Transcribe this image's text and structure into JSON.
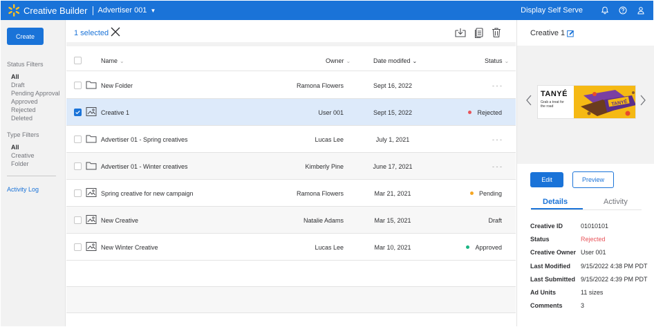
{
  "app": {
    "brand": "Creative Builder",
    "advertiser": "Advertiser 001",
    "right_link": "Display Self Serve",
    "icons": [
      "bell-icon",
      "help-icon",
      "user-icon"
    ],
    "accent": "#1a73d8"
  },
  "sidebar": {
    "create_label": "Create",
    "status_title": "Status Filters",
    "status_items": [
      "All",
      "Draft",
      "Pending Approval",
      "Approved",
      "Rejected",
      "Deleted"
    ],
    "type_title": "Type Filters",
    "type_items": [
      "All",
      "Creative",
      "Folder"
    ],
    "activity_log": "Activity Log"
  },
  "actionbar": {
    "selected_text": "1 selected",
    "icons": [
      "download-icon",
      "copy-icon",
      "trash-icon"
    ]
  },
  "table": {
    "headers": {
      "name": "Name",
      "owner": "Owner",
      "date": "Date modifed",
      "status": "Status"
    },
    "rows": [
      {
        "type": "folder",
        "name": "New Folder",
        "owner": "Ramona Flowers",
        "date": "Sept 16, 2022",
        "status": "- - -",
        "dot": "",
        "checked": false
      },
      {
        "type": "creative",
        "name": "Creative 1",
        "owner": "User 001",
        "date": "Sept 15, 2022",
        "status": "Rejected",
        "dot": "#e8545a",
        "checked": true
      },
      {
        "type": "folder",
        "name": "Advertiser 01 - Spring creatives",
        "owner": "Lucas Lee",
        "date": "July 1, 2021",
        "status": "- - -",
        "dot": "",
        "checked": false
      },
      {
        "type": "folder",
        "name": "Advertiser 01 - Winter creatives",
        "owner": "Kimberly Pine",
        "date": "June 17, 2021",
        "status": "- - -",
        "dot": "",
        "checked": false
      },
      {
        "type": "creative",
        "name": "Spring creative for new campaign",
        "owner": "Ramona Flowers",
        "date": "Mar 21, 2021",
        "status": "Pending",
        "dot": "#f5a623",
        "checked": false
      },
      {
        "type": "creative",
        "name": "New Creative",
        "owner": "Natalie Adams",
        "date": "Mar 15, 2021",
        "status": "Draft",
        "dot": "",
        "checked": false
      },
      {
        "type": "creative",
        "name": "New Winter Creative",
        "owner": "Lucas Lee",
        "date": "Mar 10, 2021",
        "status": "Approved",
        "dot": "#1bb583",
        "checked": false
      }
    ]
  },
  "panel": {
    "title": "Creative 1",
    "banner": {
      "brand": "TANYÉ",
      "tagline": "Grab a treat for the road"
    },
    "edit_label": "Edit",
    "preview_label": "Preview",
    "tabs": [
      "Details",
      "Activity"
    ],
    "details": [
      {
        "label": "Creative ID",
        "value": "01010101"
      },
      {
        "label": "Status",
        "value": "Rejected"
      },
      {
        "label": "Creative Owner",
        "value": "User 001"
      },
      {
        "label": "Last Modified",
        "value": "9/15/2022 4:38 PM PDT"
      },
      {
        "label": "Last Submitted",
        "value": "9/15/2022 4:39 PM PDT"
      },
      {
        "label": "Ad Units",
        "value": "11 sizes"
      },
      {
        "label": "Comments",
        "value": "3"
      }
    ]
  }
}
